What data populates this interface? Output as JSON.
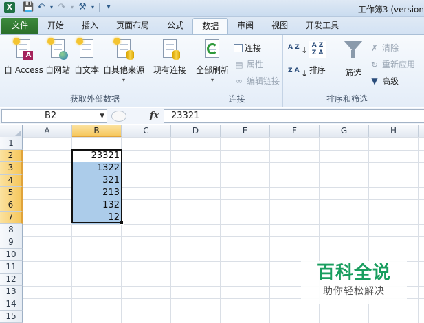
{
  "window": {
    "title": "工作簿3 (version"
  },
  "ribbon_tabs": [
    "文件",
    "开始",
    "插入",
    "页面布局",
    "公式",
    "数据",
    "审阅",
    "视图",
    "开发工具"
  ],
  "active_tab": "数据",
  "groups": {
    "external": {
      "label": "获取外部数据",
      "buttons": [
        "自 Access",
        "自网站",
        "自文本",
        "自其他来源",
        "现有连接"
      ]
    },
    "connections": {
      "label": "连接",
      "refresh_all": "全部刷新",
      "connections_btn": "连接",
      "properties_btn": "属性",
      "edit_links_btn": "编辑链接"
    },
    "sort_filter": {
      "label": "排序和筛选",
      "sort_btn": "排序",
      "filter_btn": "筛选",
      "clear_btn": "清除",
      "reapply_btn": "重新应用",
      "advanced_btn": "高级",
      "sort_az_glyph": "A Z",
      "sort_za_glyph": "Z A",
      "sort_dialog_glyph": "A Z\nZ A"
    }
  },
  "formula_bar": {
    "name_box": "B2",
    "fx_label": "fx",
    "formula": "23321"
  },
  "columns": [
    "A",
    "B",
    "C",
    "D",
    "E",
    "F",
    "G",
    "H"
  ],
  "selected_column": "B",
  "rows": [
    "1",
    "2",
    "3",
    "4",
    "5",
    "6",
    "7",
    "8",
    "9",
    "10",
    "11",
    "12",
    "13",
    "14",
    "15"
  ],
  "selected_rows": [
    "2",
    "3",
    "4",
    "5",
    "6",
    "7"
  ],
  "cells_B": [
    "23321",
    "1322",
    "321",
    "213",
    "132",
    "12"
  ],
  "watermark": {
    "title": "百科全说",
    "subtitle": "助你轻松解决"
  },
  "colors": {
    "file_tab": "#2a6e2a",
    "selection": "#acccea",
    "header_selected": "#f6c75c",
    "watermark": "#1a9e5f"
  },
  "icons": [
    "save-icon",
    "undo-icon",
    "redo-icon",
    "tools-icon",
    "customize-qat-icon",
    "funnel-icon"
  ]
}
